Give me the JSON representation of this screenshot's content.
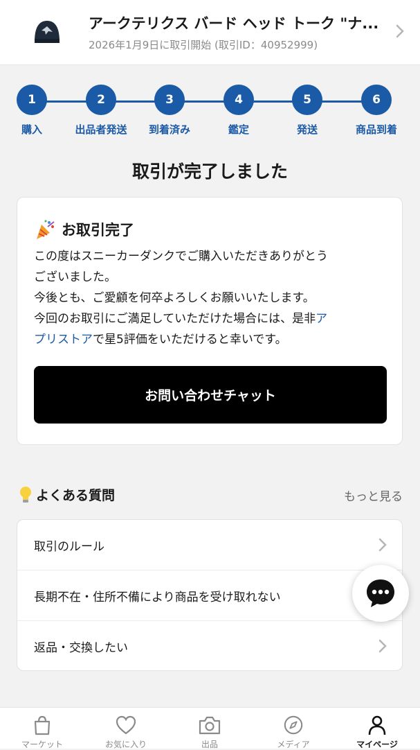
{
  "header": {
    "title": "アークテリクス バード ヘッド トーク \"ナ...",
    "subtitle": "2026年1月9日に取引開始 (取引ID：40952999)",
    "thumbnail_icon": "beanie-product-image",
    "chevron_icon": "chevron-right-icon"
  },
  "steps": [
    {
      "number": "1",
      "label": "購入"
    },
    {
      "number": "2",
      "label": "出品者発送"
    },
    {
      "number": "3",
      "label": "到着済み"
    },
    {
      "number": "4",
      "label": "鑑定"
    },
    {
      "number": "5",
      "label": "発送"
    },
    {
      "number": "6",
      "label": "商品到着"
    }
  ],
  "status_title": "取引が完了しました",
  "completion_card": {
    "heading": "お取引完了",
    "line1": "この度はスニーカーダンクでご購入いただきありがとう",
    "line2": "ございました。",
    "line3": "今後とも、ご愛顧を何卒よろしくお願いいたします。",
    "line4_prefix": "今回のお取引にご満足していただけた場合には、是非",
    "line4_link_part1": "ア",
    "line5_link_part2": "プリストア",
    "line5_suffix": "で星5評価をいただけると幸いです。",
    "chat_button": "お問い合わせチャット"
  },
  "faq": {
    "title": "よくある質問",
    "more": "もっと見る",
    "items": [
      {
        "label": "取引のルール"
      },
      {
        "label": "長期不在・住所不備により商品を受け取れない"
      },
      {
        "label": "返品・交換したい"
      }
    ]
  },
  "tabbar": {
    "tabs": [
      {
        "label": "マーケット",
        "icon": "bag-icon"
      },
      {
        "label": "お気に入り",
        "icon": "heart-icon"
      },
      {
        "label": "出品",
        "icon": "camera-icon"
      },
      {
        "label": "メディア",
        "icon": "compass-icon"
      },
      {
        "label": "マイページ",
        "icon": "person-icon",
        "active": true
      }
    ]
  },
  "colors": {
    "accent": "#1b5aa6",
    "button": "#000000",
    "background": "#f2f2f2"
  }
}
